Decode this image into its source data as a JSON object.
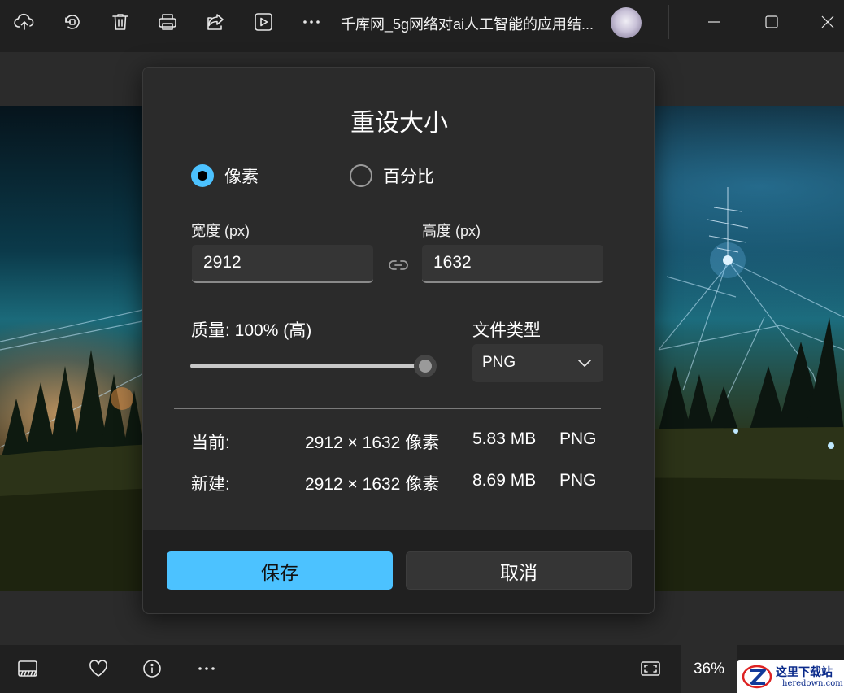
{
  "window": {
    "title": "千库网_5g网络对ai人工智能的应用结..."
  },
  "toolbar": {
    "icons": [
      "cloud-upload-icon",
      "rotate-icon",
      "trash-icon",
      "print-icon",
      "share-icon",
      "slideshow-icon",
      "more-icon"
    ]
  },
  "dialog": {
    "title": "重设大小",
    "mode_pixels": "像素",
    "mode_percent": "百分比",
    "width_label": "宽度 (px)",
    "width_value": "2912",
    "height_label": "高度 (px)",
    "height_value": "1632",
    "quality_label": "质量: 100% (高)",
    "quality_level": 1.0,
    "filetype_label": "文件类型",
    "filetype_value": "PNG",
    "current": {
      "label": "当前:",
      "dimensions": "2912 × 1632 像素",
      "size": "5.83 MB",
      "type": "PNG"
    },
    "new": {
      "label": "新建:",
      "dimensions": "2912 × 1632 像素",
      "size": "8.69 MB",
      "type": "PNG"
    },
    "save_label": "保存",
    "cancel_label": "取消"
  },
  "bottombar": {
    "zoom": "36%"
  },
  "watermark": {
    "text": "这里下载站",
    "sub": "heredown.com"
  },
  "colors": {
    "accent": "#4cc2ff",
    "dialog_bg": "#2b2b2b",
    "chrome_bg": "#202020"
  }
}
